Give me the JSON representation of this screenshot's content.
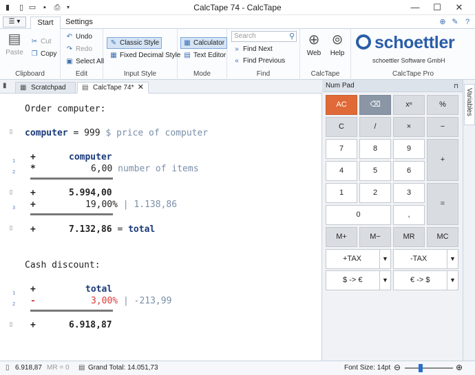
{
  "window": {
    "title": "CalcTape 74 - CalcTape",
    "minimize": "—",
    "maximize": "☐",
    "close": "✕"
  },
  "ribbon_tabs": {
    "file": "☰ ▾",
    "start": "Start",
    "settings": "Settings"
  },
  "clipboard": {
    "label": "Clipboard",
    "paste": "Paste",
    "cut": "Cut",
    "copy": "Copy"
  },
  "edit": {
    "label": "Edit",
    "undo": "Undo",
    "redo": "Redo",
    "select_all": "Select All"
  },
  "input_style": {
    "label": "Input Style",
    "classic": "Classic Style",
    "fixed_decimal": "Fixed Decimal Style"
  },
  "mode": {
    "label": "Mode",
    "calculator": "Calculator",
    "text_editor": "Text Editor"
  },
  "find": {
    "label": "Find",
    "search_placeholder": "Search",
    "find_next": "Find Next",
    "find_previous": "Find Previous"
  },
  "calctape_group": {
    "label": "CalcTape",
    "web": "Web",
    "help": "Help"
  },
  "calctape_pro": {
    "label": "CalcTape Pro",
    "logo": "schoettler",
    "company": "schoettler Software GmbH"
  },
  "doc_tabs": {
    "scratchpad": "Scratchpad",
    "current": "CalcTape 74*",
    "close": "✕"
  },
  "tape": {
    "heading1": "Order computer:",
    "var_name": "computer",
    "var_expr": " = 999 ",
    "var_comment": "$ price of computer",
    "l1_op": "+",
    "l1_val": "computer",
    "l1_num": "1",
    "l2_op": "*",
    "l2_val": "6,00",
    "l2_comment": " number of items",
    "l2_num": "2",
    "sub1_op": "+",
    "sub1_val": "5.994,00",
    "l3_op": "+",
    "l3_val": "19,00%",
    "l3_comment": " | 1.138,86",
    "l3_num": "3",
    "sub2_op": "+",
    "sub2_val": "7.132,86",
    "sub2_assign": " = ",
    "sub2_var": "total",
    "heading2": "Cash discount:",
    "m1_op": "+",
    "m1_val": "total",
    "m1_num": "1",
    "m2_op": "-",
    "m2_val": "3,00%",
    "m2_comment": " | -213,99",
    "m2_num": "2",
    "result_op": "+",
    "result_val": "6.918,87"
  },
  "numpad": {
    "title": "Num Pad",
    "pin": "⊓",
    "keys": {
      "ac": "AC",
      "bs": "⌫",
      "pow": "xⁿ",
      "pct": "%",
      "c": "C",
      "div": "/",
      "mul": "×",
      "minus": "−",
      "k7": "7",
      "k8": "8",
      "k9": "9",
      "plus": "+",
      "k4": "4",
      "k5": "5",
      "k6": "6",
      "k1": "1",
      "k2": "2",
      "k3": "3",
      "eq": "=",
      "k0": "0",
      "dec": ",",
      "mplus": "M+",
      "mminus": "M−",
      "mr": "MR",
      "mc": "MC",
      "tax_plus": "+TAX",
      "tax_minus": "-TAX",
      "usd_eur": "$ -> €",
      "eur_usd": "€ -> $",
      "arrow": "▼"
    }
  },
  "side_panel": {
    "variables": "Variables"
  },
  "status": {
    "value": "6.918,87",
    "memory": "MR = 0",
    "grand_total": "Grand Total: 14.051,73",
    "font_size": "Font Size: 14pt",
    "zoom_out": "⊖",
    "zoom_in": "⊕"
  }
}
